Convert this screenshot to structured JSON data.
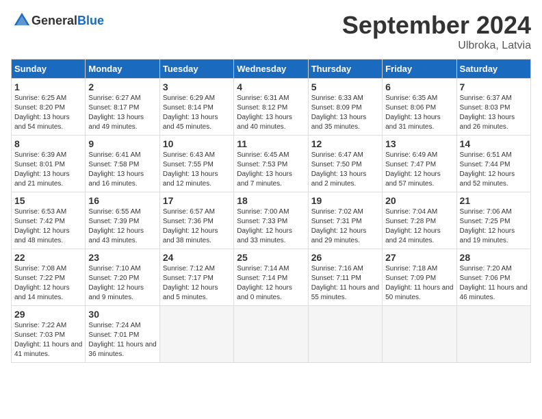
{
  "header": {
    "logo_general": "General",
    "logo_blue": "Blue",
    "month_year": "September 2024",
    "location": "Ulbroka, Latvia"
  },
  "weekdays": [
    "Sunday",
    "Monday",
    "Tuesday",
    "Wednesday",
    "Thursday",
    "Friday",
    "Saturday"
  ],
  "days": [
    {
      "num": "",
      "sunrise": "",
      "sunset": "",
      "daylight": "",
      "empty": true
    },
    {
      "num": "1",
      "sunrise": "6:25 AM",
      "sunset": "8:20 PM",
      "daylight": "13 hours and 54 minutes."
    },
    {
      "num": "2",
      "sunrise": "6:27 AM",
      "sunset": "8:17 PM",
      "daylight": "13 hours and 49 minutes."
    },
    {
      "num": "3",
      "sunrise": "6:29 AM",
      "sunset": "8:14 PM",
      "daylight": "13 hours and 45 minutes."
    },
    {
      "num": "4",
      "sunrise": "6:31 AM",
      "sunset": "8:12 PM",
      "daylight": "13 hours and 40 minutes."
    },
    {
      "num": "5",
      "sunrise": "6:33 AM",
      "sunset": "8:09 PM",
      "daylight": "13 hours and 35 minutes."
    },
    {
      "num": "6",
      "sunrise": "6:35 AM",
      "sunset": "8:06 PM",
      "daylight": "13 hours and 31 minutes."
    },
    {
      "num": "7",
      "sunrise": "6:37 AM",
      "sunset": "8:03 PM",
      "daylight": "13 hours and 26 minutes."
    },
    {
      "num": "8",
      "sunrise": "6:39 AM",
      "sunset": "8:01 PM",
      "daylight": "13 hours and 21 minutes."
    },
    {
      "num": "9",
      "sunrise": "6:41 AM",
      "sunset": "7:58 PM",
      "daylight": "13 hours and 16 minutes."
    },
    {
      "num": "10",
      "sunrise": "6:43 AM",
      "sunset": "7:55 PM",
      "daylight": "13 hours and 12 minutes."
    },
    {
      "num": "11",
      "sunrise": "6:45 AM",
      "sunset": "7:53 PM",
      "daylight": "13 hours and 7 minutes."
    },
    {
      "num": "12",
      "sunrise": "6:47 AM",
      "sunset": "7:50 PM",
      "daylight": "13 hours and 2 minutes."
    },
    {
      "num": "13",
      "sunrise": "6:49 AM",
      "sunset": "7:47 PM",
      "daylight": "12 hours and 57 minutes."
    },
    {
      "num": "14",
      "sunrise": "6:51 AM",
      "sunset": "7:44 PM",
      "daylight": "12 hours and 52 minutes."
    },
    {
      "num": "15",
      "sunrise": "6:53 AM",
      "sunset": "7:42 PM",
      "daylight": "12 hours and 48 minutes."
    },
    {
      "num": "16",
      "sunrise": "6:55 AM",
      "sunset": "7:39 PM",
      "daylight": "12 hours and 43 minutes."
    },
    {
      "num": "17",
      "sunrise": "6:57 AM",
      "sunset": "7:36 PM",
      "daylight": "12 hours and 38 minutes."
    },
    {
      "num": "18",
      "sunrise": "7:00 AM",
      "sunset": "7:33 PM",
      "daylight": "12 hours and 33 minutes."
    },
    {
      "num": "19",
      "sunrise": "7:02 AM",
      "sunset": "7:31 PM",
      "daylight": "12 hours and 29 minutes."
    },
    {
      "num": "20",
      "sunrise": "7:04 AM",
      "sunset": "7:28 PM",
      "daylight": "12 hours and 24 minutes."
    },
    {
      "num": "21",
      "sunrise": "7:06 AM",
      "sunset": "7:25 PM",
      "daylight": "12 hours and 19 minutes."
    },
    {
      "num": "22",
      "sunrise": "7:08 AM",
      "sunset": "7:22 PM",
      "daylight": "12 hours and 14 minutes."
    },
    {
      "num": "23",
      "sunrise": "7:10 AM",
      "sunset": "7:20 PM",
      "daylight": "12 hours and 9 minutes."
    },
    {
      "num": "24",
      "sunrise": "7:12 AM",
      "sunset": "7:17 PM",
      "daylight": "12 hours and 5 minutes."
    },
    {
      "num": "25",
      "sunrise": "7:14 AM",
      "sunset": "7:14 PM",
      "daylight": "12 hours and 0 minutes."
    },
    {
      "num": "26",
      "sunrise": "7:16 AM",
      "sunset": "7:11 PM",
      "daylight": "11 hours and 55 minutes."
    },
    {
      "num": "27",
      "sunrise": "7:18 AM",
      "sunset": "7:09 PM",
      "daylight": "11 hours and 50 minutes."
    },
    {
      "num": "28",
      "sunrise": "7:20 AM",
      "sunset": "7:06 PM",
      "daylight": "11 hours and 46 minutes."
    },
    {
      "num": "29",
      "sunrise": "7:22 AM",
      "sunset": "7:03 PM",
      "daylight": "11 hours and 41 minutes."
    },
    {
      "num": "30",
      "sunrise": "7:24 AM",
      "sunset": "7:01 PM",
      "daylight": "11 hours and 36 minutes."
    },
    {
      "num": "",
      "sunrise": "",
      "sunset": "",
      "daylight": "",
      "empty": true
    },
    {
      "num": "",
      "sunrise": "",
      "sunset": "",
      "daylight": "",
      "empty": true
    },
    {
      "num": "",
      "sunrise": "",
      "sunset": "",
      "daylight": "",
      "empty": true
    },
    {
      "num": "",
      "sunrise": "",
      "sunset": "",
      "daylight": "",
      "empty": true
    },
    {
      "num": "",
      "sunrise": "",
      "sunset": "",
      "daylight": "",
      "empty": true
    }
  ]
}
